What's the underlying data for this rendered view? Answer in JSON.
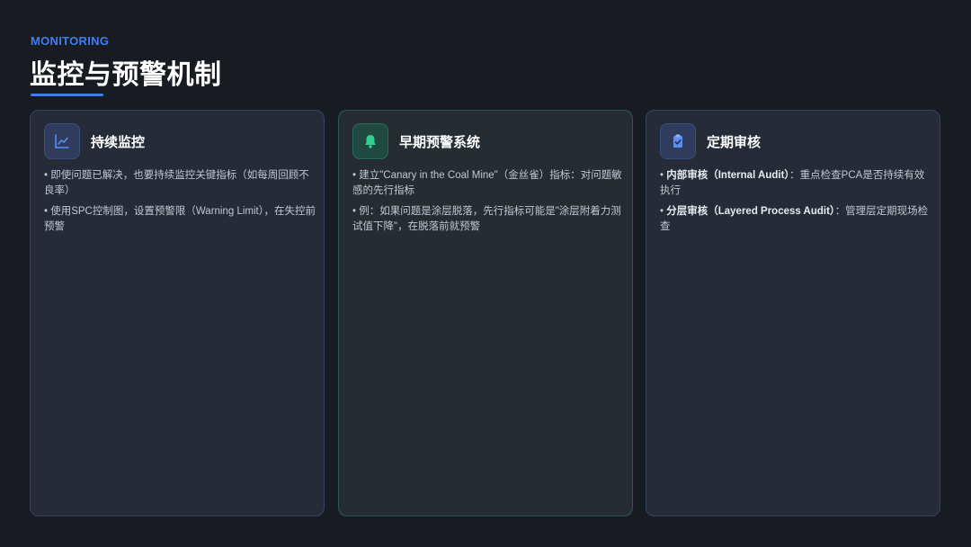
{
  "header": {
    "eyebrow": "MONITORING",
    "title": "监控与预警机制"
  },
  "colors": {
    "accent_blue": "#3d7ef0",
    "accent_green": "#2fd08f",
    "background": "#181c22"
  },
  "cards": [
    {
      "icon": "line-chart-icon",
      "title": "持续监控",
      "items": [
        {
          "text": "• 即使问题已解决，也要持续监控关键指标（如每周回顾不良率）"
        },
        {
          "text": "• 使用SPC控制图，设置预警限（Warning Limit），在失控前预警"
        }
      ]
    },
    {
      "icon": "bell-icon",
      "title": "早期预警系统",
      "items": [
        {
          "text": "• 建立\"Canary in the Coal Mine\"（金丝雀）指标：对问题敏感的先行指标"
        },
        {
          "text": "• 例：如果问题是涂层脱落，先行指标可能是\"涂层附着力测试值下降\"，在脱落前就预警"
        }
      ]
    },
    {
      "icon": "clipboard-check-icon",
      "title": "定期审核",
      "items": [
        {
          "bullet": "• ",
          "bold": "内部审核（Internal Audit）",
          "text": "：重点检查PCA是否持续有效执行"
        },
        {
          "bullet": "• ",
          "bold": "分层审核（Layered Process Audit）",
          "text": "：管理层定期现场检查"
        }
      ]
    }
  ]
}
